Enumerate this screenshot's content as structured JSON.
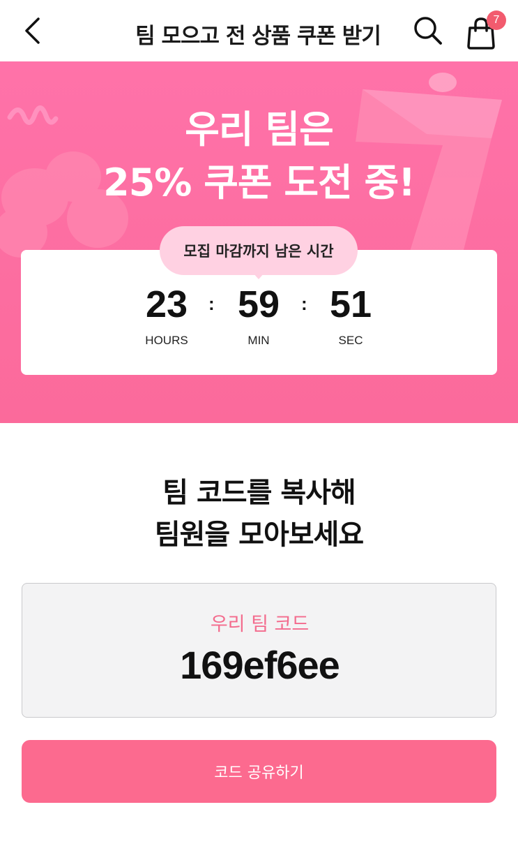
{
  "header": {
    "title": "팀 모으고 전 상품 쿠폰 받기",
    "back_icon": "chevron-left-icon",
    "search_icon": "search-icon",
    "cart_icon": "shopping-bag-icon",
    "cart_count": "7"
  },
  "hero": {
    "title_line1": "우리 팀은",
    "title_line2": "25% 쿠폰 도전 중!",
    "background_color": "#fd6fa3",
    "timer": {
      "caption": "모집 마감까지 남은 시간",
      "hours": "23",
      "minutes": "59",
      "seconds": "51",
      "hours_label": "HOURS",
      "minutes_label": "MIN",
      "seconds_label": "SEC",
      "separator": ":"
    }
  },
  "team": {
    "heading_line1": "팀 코드를 복사해",
    "heading_line2": "팀원을 모아보세요",
    "code_label": "우리 팀 코드",
    "code_value": "169ef6ee",
    "share_button": "코드 공유하기",
    "accent_color": "#fc6a8f"
  }
}
